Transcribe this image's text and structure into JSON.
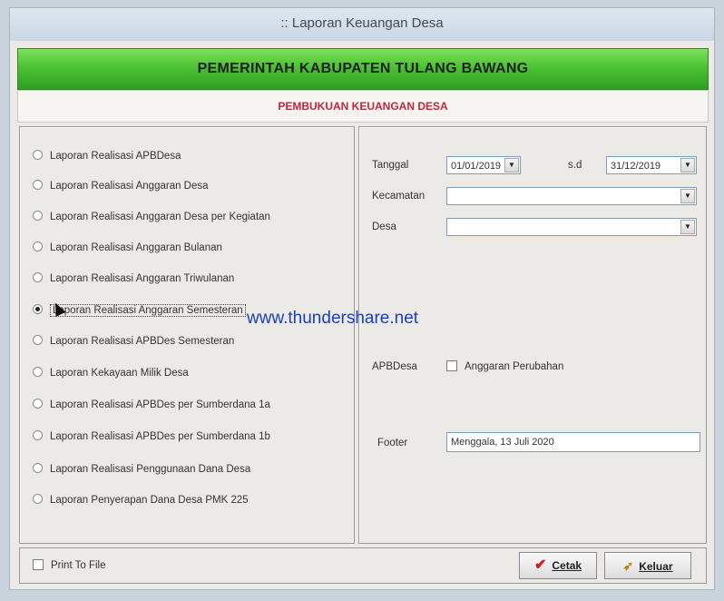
{
  "window": {
    "title": ":: Laporan Keuangan Desa"
  },
  "header": {
    "title": "PEMERINTAH KABUPATEN TULANG BAWANG",
    "subtitle": "PEMBUKUAN KEUANGAN DESA"
  },
  "reports": [
    {
      "label": "Laporan Realisasi APBDesa",
      "selected": false
    },
    {
      "label": "Laporan Realisasi Anggaran Desa",
      "selected": false
    },
    {
      "label": "Laporan Realisasi Anggaran Desa per Kegiatan",
      "selected": false
    },
    {
      "label": "Laporan Realisasi Anggaran Bulanan",
      "selected": false
    },
    {
      "label": "Laporan Realisasi Anggaran Triwulanan",
      "selected": false
    },
    {
      "label": "Laporan Realisasi Anggaran Semesteran",
      "selected": true
    },
    {
      "label": "Laporan Realisasi APBDes Semesteran",
      "selected": false
    },
    {
      "label": "Laporan Kekayaan Milik Desa",
      "selected": false
    },
    {
      "label": "Laporan Realisasi APBDes per Sumberdana 1a",
      "selected": false
    },
    {
      "label": "Laporan Realisasi APBDes per Sumberdana 1b",
      "selected": false
    },
    {
      "label": "Laporan Realisasi Penggunaan Dana Desa",
      "selected": false
    },
    {
      "label": "Laporan Penyerapan Dana Desa PMK 225",
      "selected": false
    }
  ],
  "filters": {
    "tanggal_label": "Tanggal",
    "date_from": "01/01/2019",
    "sd_label": "s.d",
    "date_to": "31/12/2019",
    "kecamatan_label": "Kecamatan",
    "kecamatan_value": "",
    "desa_label": "Desa",
    "desa_value": "",
    "apbdesa_label": "APBDesa",
    "perubahan_label": "Anggaran Perubahan",
    "perubahan_checked": false,
    "footer_label": "Footer",
    "footer_value": "Menggala, 13 Juli 2020"
  },
  "bottom": {
    "print_to_file_label": "Print To File",
    "print_to_file_checked": false,
    "cetak_label": "Cetak",
    "keluar_label": "Keluar"
  },
  "watermark": "www.thundershare.net"
}
